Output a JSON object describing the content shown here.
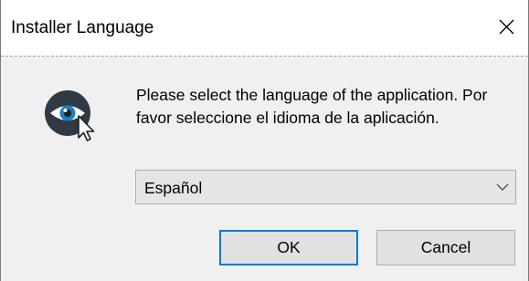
{
  "window": {
    "title": "Installer Language"
  },
  "icons": {
    "app_icon": "eye-with-cursor-icon",
    "close_icon": "close-icon",
    "dropdown_icon": "chevron-down-icon"
  },
  "content": {
    "message": "Please select the language of the application. Por favor seleccione el idioma de la aplicación."
  },
  "language_select": {
    "selected": "Español"
  },
  "buttons": {
    "ok_label": "OK",
    "cancel_label": "Cancel"
  },
  "colors": {
    "focus_border": "#0078d7",
    "dialog_background": "#f0f0f0",
    "icon_dark": "#2f3a44"
  }
}
